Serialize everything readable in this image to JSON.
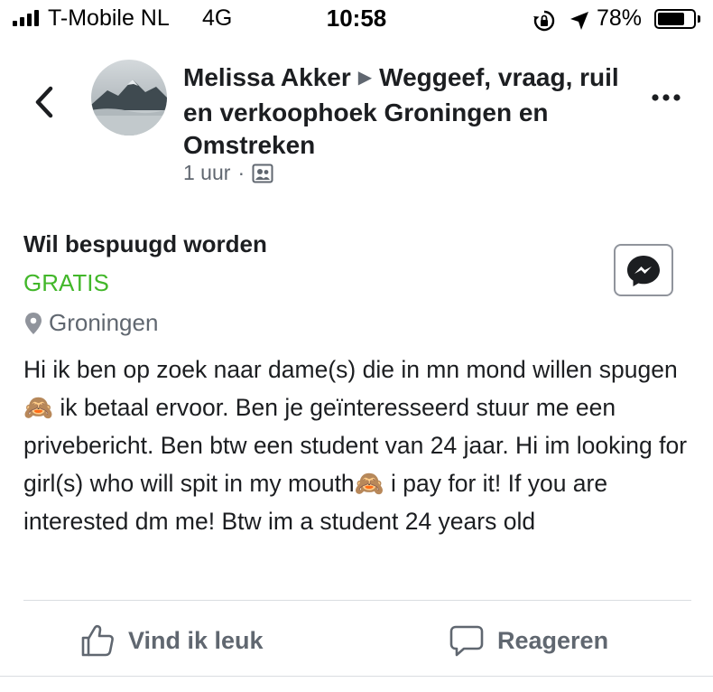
{
  "status_bar": {
    "carrier": "T-Mobile NL",
    "network": "4G",
    "time": "10:58",
    "battery_percent": "78%",
    "battery_level": 0.78,
    "icons": [
      "signal-bars-icon",
      "rotation-lock-icon",
      "location-arrow-icon",
      "battery-icon"
    ]
  },
  "header": {
    "author": "Melissa Akker",
    "separator": "▶",
    "group": "Weggeef, vraag, ruil en verkoophoek Groningen en Omstreken",
    "time_ago": "1 uur",
    "dot": "·",
    "icons": [
      "back-chevron-icon",
      "more-dots-icon",
      "group-icon"
    ]
  },
  "post": {
    "title": "Wil bespuugd worden",
    "price": "GRATIS",
    "location": "Groningen",
    "text_part1": "Hi ik ben op zoek naar dame(s) die in mn mond willen spugen",
    "emoji1": "🙈",
    "text_part2": " ik betaal ervoor. Ben je geïnteresseerd stuur me een privebericht. Ben btw een student van 24 jaar. Hi im looking for girl(s) who will spit in my mouth",
    "emoji2": "🙈",
    "text_part3": " i pay for it! If you are interested dm me! Btw im a student 24 years old",
    "icons": [
      "location-pin-icon",
      "messenger-icon"
    ]
  },
  "actions": {
    "like_label": "Vind ik leuk",
    "comment_label": "Reageren",
    "icons": [
      "thumbs-up-icon",
      "comment-bubble-icon"
    ]
  },
  "colors": {
    "price_green": "#42b72a",
    "secondary_text": "#606770",
    "primary_text": "#1c1e21"
  }
}
